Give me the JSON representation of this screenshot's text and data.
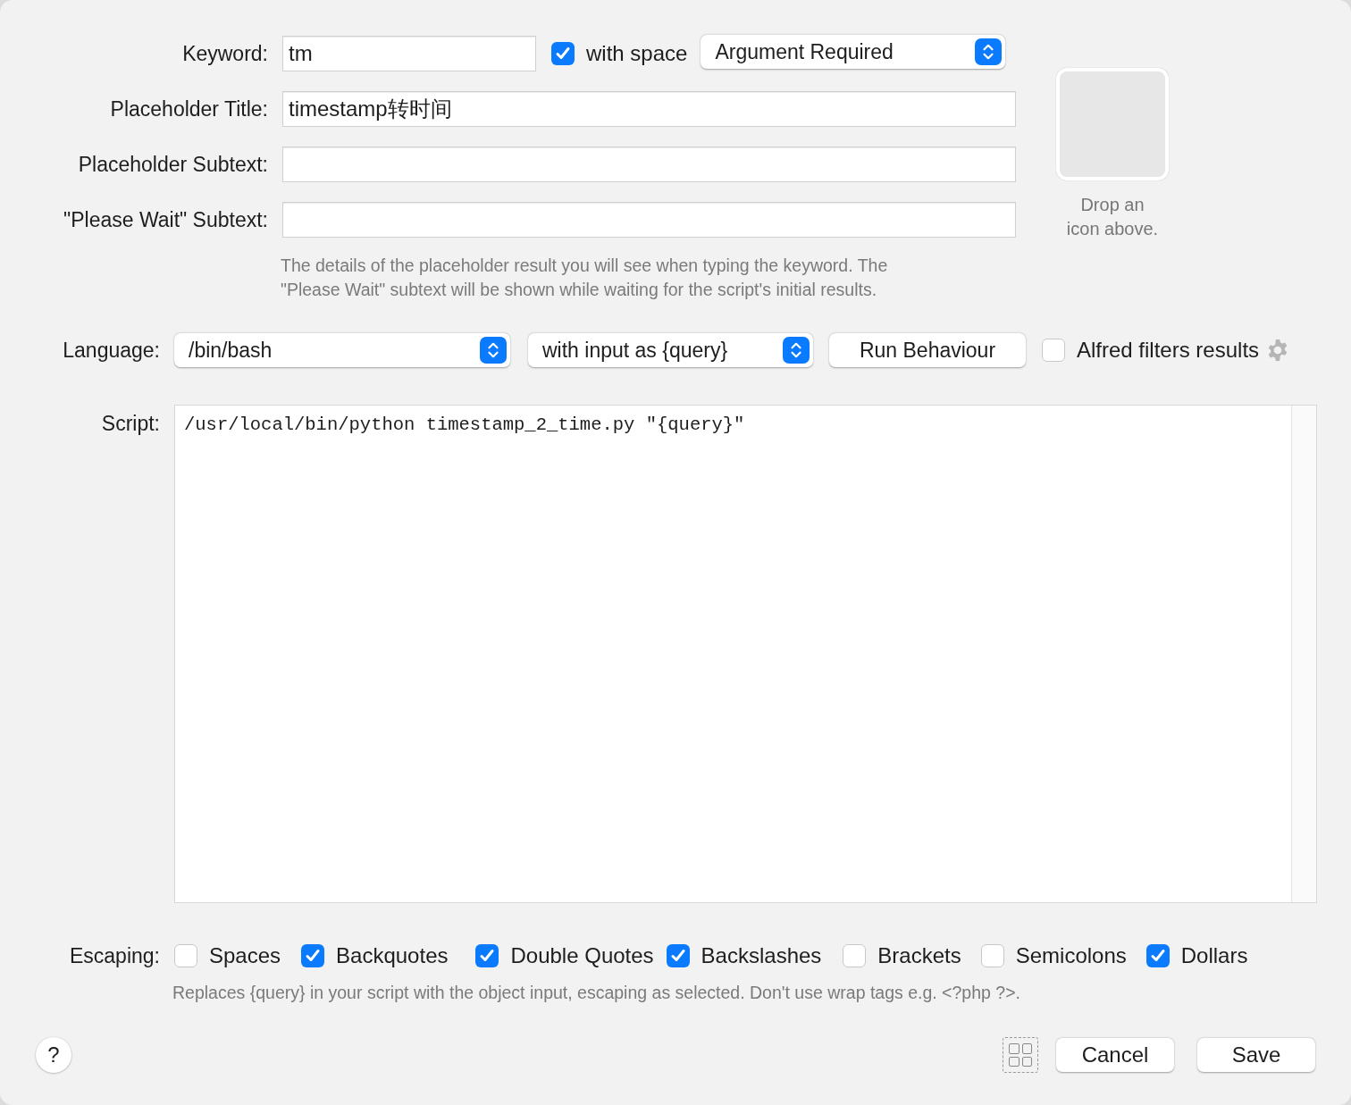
{
  "keyword": {
    "label": "Keyword:",
    "value": "tm"
  },
  "with_space": {
    "label": "with space",
    "checked": true
  },
  "argument_popup": {
    "value": "Argument Required"
  },
  "fields": [
    {
      "label": "Placeholder Title:",
      "value": "timestamp转时间"
    },
    {
      "label": "Placeholder Subtext:"
    },
    {
      "label": "\"Please Wait\" Subtext:"
    }
  ],
  "fields_help": [
    "The details of the placeholder result you will see when typing the keyword. The",
    "\"Please Wait\" subtext will be shown while waiting for the script's initial results."
  ],
  "icon_well": {
    "caption_lines": [
      "Drop an",
      "icon above."
    ]
  },
  "language": {
    "label": "Language:",
    "value": "/bin/bash"
  },
  "input_mode": {
    "value": "with input as {query}"
  },
  "run_behaviour_button": "Run Behaviour",
  "alfred_filters": {
    "label": "Alfred filters results",
    "checked": false
  },
  "script": {
    "label": "Script:",
    "code": "/usr/local/bin/python timestamp_2_time.py \"{query}\""
  },
  "escaping": {
    "label": "Escaping:",
    "options": [
      {
        "label": "Spaces",
        "checked": false
      },
      {
        "label": "Backquotes",
        "checked": true
      },
      {
        "label": "Double Quotes",
        "checked": true
      },
      {
        "label": "Backslashes",
        "checked": true
      },
      {
        "label": "Brackets",
        "checked": false
      },
      {
        "label": "Semicolons",
        "checked": false
      },
      {
        "label": "Dollars",
        "checked": true
      }
    ]
  },
  "escaping_help": "Replaces {query} in your script with the object input, escaping as selected. Don't use wrap tags e.g. <?php ?>.",
  "buttons": {
    "help": "?",
    "cancel": "Cancel",
    "save": "Save"
  }
}
